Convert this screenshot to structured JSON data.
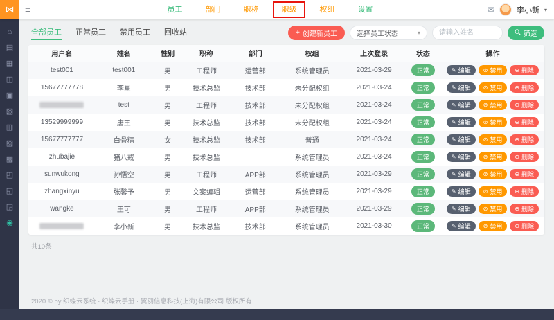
{
  "annotation": {
    "color": "#e8150d",
    "target_label": "职级"
  },
  "topbar": {
    "logo_icon": "⋈",
    "hamburger_icon": "≡",
    "mail_icon": "✉",
    "user_name": "李小新",
    "caret_icon": "▾",
    "nav": [
      {
        "label": "员工",
        "color": "#3dbd7d",
        "active": true
      },
      {
        "label": "部门",
        "color": "#ff9800"
      },
      {
        "label": "职称",
        "color": "#ff9800"
      },
      {
        "label": "职级",
        "color": "#ff9800",
        "annotated": true
      },
      {
        "label": "权组",
        "color": "#ff9800"
      },
      {
        "label": "设置",
        "color": "#3dbd7d"
      }
    ]
  },
  "sidebar": {
    "items": [
      {
        "name": "home-icon",
        "glyph": "⌂"
      },
      {
        "name": "apps-icon",
        "glyph": "▤"
      },
      {
        "name": "projects-icon",
        "glyph": "▦"
      },
      {
        "name": "team-icon",
        "glyph": "◫"
      },
      {
        "name": "calendar-icon",
        "glyph": "▣"
      },
      {
        "name": "tasks-icon",
        "glyph": "▧"
      },
      {
        "name": "documents-icon",
        "glyph": "▥"
      },
      {
        "name": "notebook-icon",
        "glyph": "▨"
      },
      {
        "name": "announcement-icon",
        "glyph": "▩"
      },
      {
        "name": "gallery-icon",
        "glyph": "◰"
      },
      {
        "name": "reports-icon",
        "glyph": "◱"
      },
      {
        "name": "tools-icon",
        "glyph": "◲"
      },
      {
        "name": "settings-icon",
        "glyph": "◉",
        "active": true
      }
    ]
  },
  "tabs": [
    {
      "label": "全部员工",
      "active": true
    },
    {
      "label": "正常员工"
    },
    {
      "label": "禁用员工"
    },
    {
      "label": "回收站"
    }
  ],
  "toolbar": {
    "create_icon": "+",
    "create_label": "创建新员工",
    "status_select_label": "选择员工状态",
    "select_caret_icon": "▾",
    "name_placeholder": "请输入姓名",
    "filter_label": "筛选"
  },
  "table": {
    "headers": [
      "用户名",
      "姓名",
      "性别",
      "职称",
      "部门",
      "权组",
      "上次登录",
      "状态",
      "操作"
    ],
    "status_color": "#5cb87a",
    "actions": [
      {
        "label": "编辑",
        "icon": "✎",
        "color": "#57606f"
      },
      {
        "label": "禁用",
        "icon": "⊘",
        "color": "#ff9800"
      },
      {
        "label": "删除",
        "icon": "⊖",
        "color": "#fa5c52"
      }
    ],
    "rows": [
      {
        "username": "test001",
        "masked": false,
        "name": "test001",
        "gender": "男",
        "title": "工程师",
        "dept": "运营部",
        "group": "系统管理员",
        "last_login": "2021-03-29",
        "status": "正常"
      },
      {
        "username": "15677777778",
        "masked": false,
        "name": "李星",
        "gender": "男",
        "title": "技术总监",
        "dept": "技术部",
        "group": "未分配权组",
        "last_login": "2021-03-24",
        "status": "正常"
      },
      {
        "username": "",
        "masked": true,
        "name": "test",
        "gender": "男",
        "title": "工程师",
        "dept": "技术部",
        "group": "未分配权组",
        "last_login": "2021-03-24",
        "status": "正常"
      },
      {
        "username": "13529999999",
        "masked": false,
        "name": "唐王",
        "gender": "男",
        "title": "技术总监",
        "dept": "技术部",
        "group": "未分配权组",
        "last_login": "2021-03-24",
        "status": "正常"
      },
      {
        "username": "15677777777",
        "masked": false,
        "name": "白骨精",
        "gender": "女",
        "title": "技术总监",
        "dept": "技术部",
        "group": "普通",
        "last_login": "2021-03-24",
        "status": "正常"
      },
      {
        "username": "zhubajie",
        "masked": false,
        "name": "猪八戒",
        "gender": "男",
        "title": "技术总监",
        "dept": "",
        "group": "系统管理员",
        "last_login": "2021-03-24",
        "status": "正常"
      },
      {
        "username": "sunwukong",
        "masked": false,
        "name": "孙悟空",
        "gender": "男",
        "title": "工程师",
        "dept": "APP部",
        "group": "系统管理员",
        "last_login": "2021-03-29",
        "status": "正常"
      },
      {
        "username": "zhangxinyu",
        "masked": false,
        "name": "张馨予",
        "gender": "男",
        "title": "文案编辑",
        "dept": "运营部",
        "group": "系统管理员",
        "last_login": "2021-03-29",
        "status": "正常"
      },
      {
        "username": "wangke",
        "masked": false,
        "name": "王可",
        "gender": "男",
        "title": "工程师",
        "dept": "APP部",
        "group": "系统管理员",
        "last_login": "2021-03-29",
        "status": "正常"
      },
      {
        "username": "",
        "masked": true,
        "name": "李小新",
        "gender": "男",
        "title": "技术总监",
        "dept": "技术部",
        "group": "系统管理员",
        "last_login": "2021-03-30",
        "status": "正常"
      }
    ]
  },
  "summary": "共10条",
  "footer": "2020 © by 织蝶云系统 · 织蝶云手册 · 翼羽信息科技(上海)有限公司 版权所有"
}
